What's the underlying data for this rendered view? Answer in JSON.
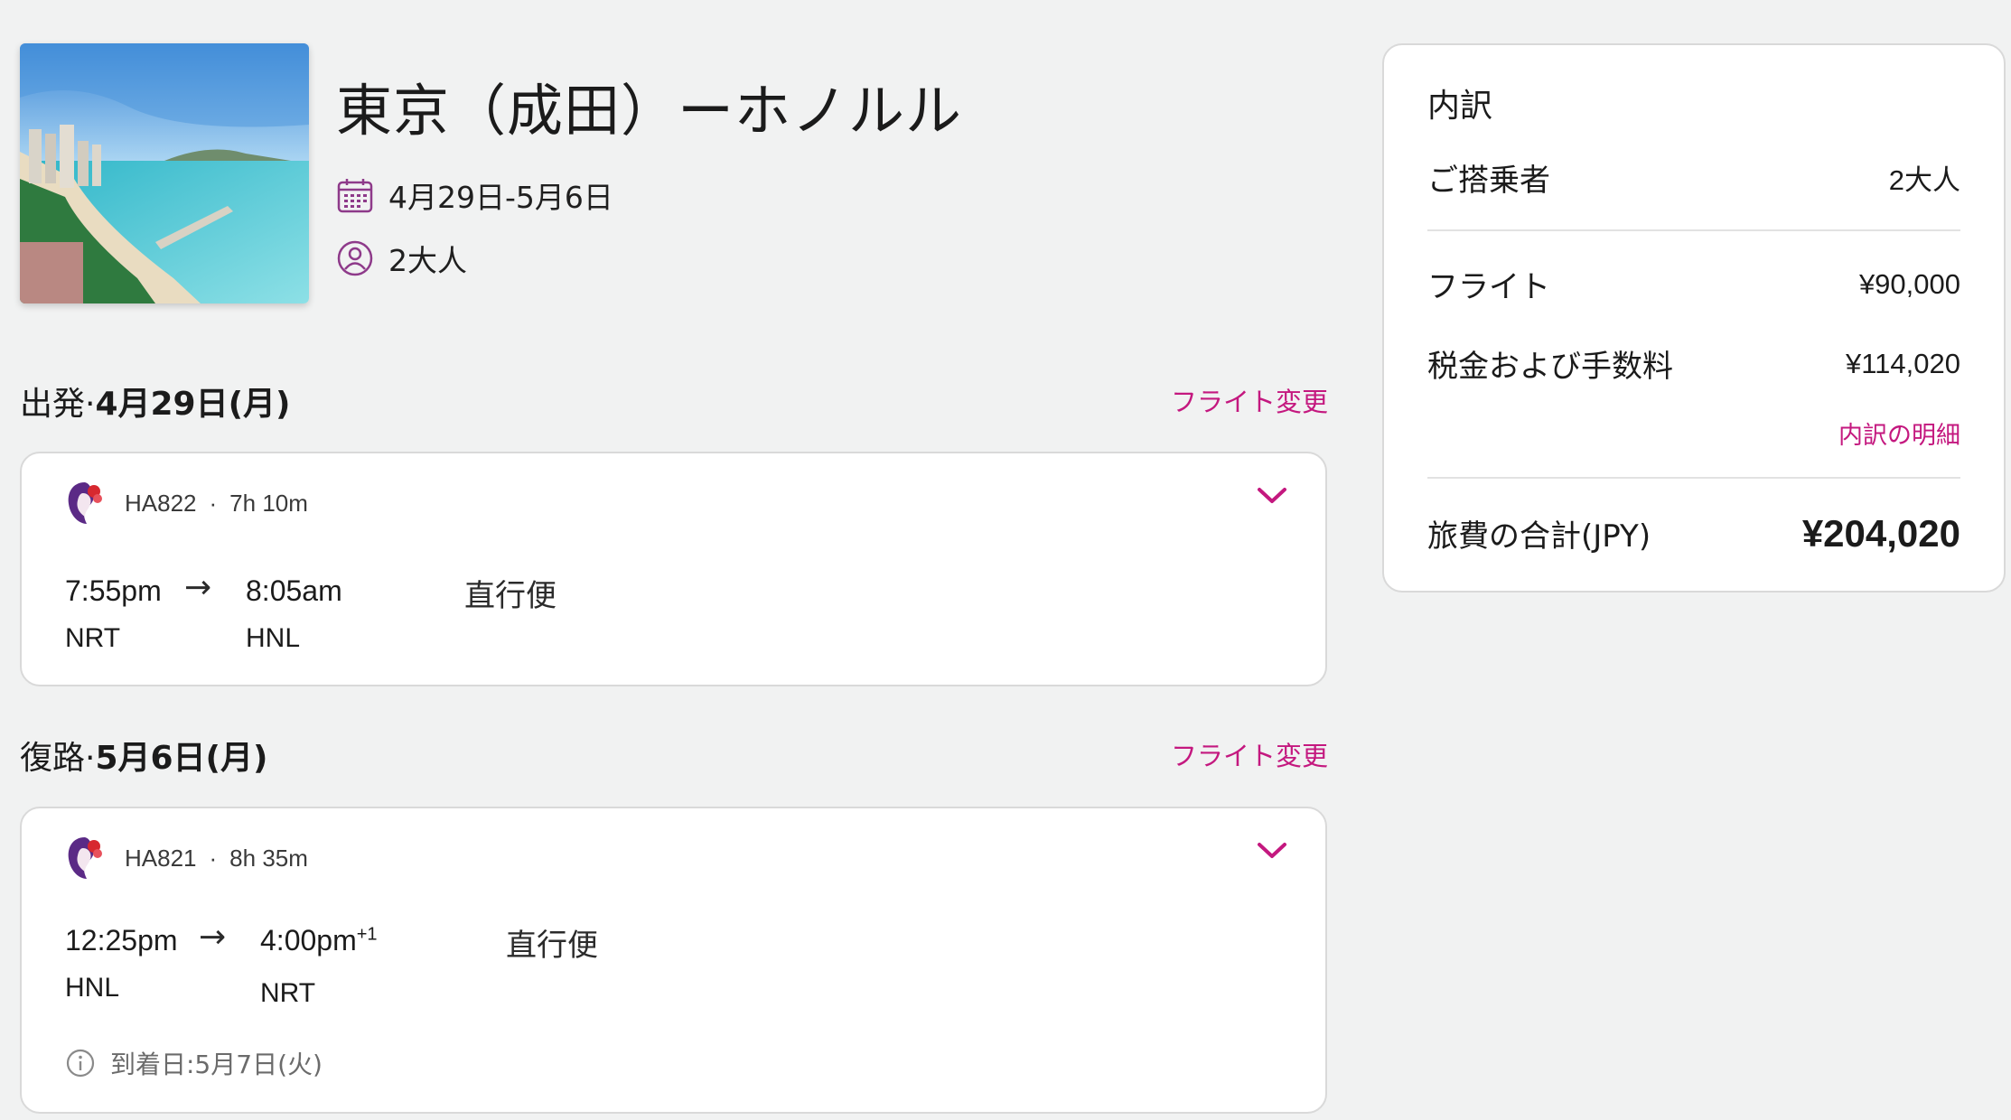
{
  "header": {
    "title": "東京（成田）ーホノルル",
    "dates": "4月29日-5月6日",
    "travelers": "2大人"
  },
  "outbound": {
    "heading_prefix": "出発·",
    "heading_date": "4月29日(月)",
    "change_label": "フライト変更",
    "flight_number": "HA822",
    "duration": "7h 10m",
    "depart_time": "7:55pm",
    "arrive_time": "8:05am",
    "arrive_day_offset": "",
    "origin": "NRT",
    "destination": "HNL",
    "stops": "直行便"
  },
  "inbound": {
    "heading_prefix": "復路·",
    "heading_date": "5月6日(月)",
    "change_label": "フライト変更",
    "flight_number": "HA821",
    "duration": "8h 35m",
    "depart_time": "12:25pm",
    "arrive_time": "4:00pm",
    "arrive_day_offset": "+1",
    "origin": "HNL",
    "destination": "NRT",
    "stops": "直行便",
    "arrival_note": "到着日:5月7日(火)"
  },
  "summary": {
    "title": "内訳",
    "passengers_label": "ご搭乗者",
    "passengers_value": "2大人",
    "flight_label": "フライト",
    "flight_value": "¥90,000",
    "tax_label": "税金および手数料",
    "tax_value": "¥114,020",
    "details_link": "内訳の明細",
    "total_label": "旅費の合計(JPY)",
    "total_value": "¥204,020"
  },
  "colors": {
    "accent": "#c4187f",
    "background": "#f1f2f2",
    "card": "#ffffff",
    "icon_purple": "#8e3a8a"
  },
  "icons": {
    "calendar": "calendar-icon",
    "traveler": "user-icon",
    "airline": "hawaiian-airlines-logo",
    "expand": "chevron-down-icon",
    "info": "info-icon"
  }
}
